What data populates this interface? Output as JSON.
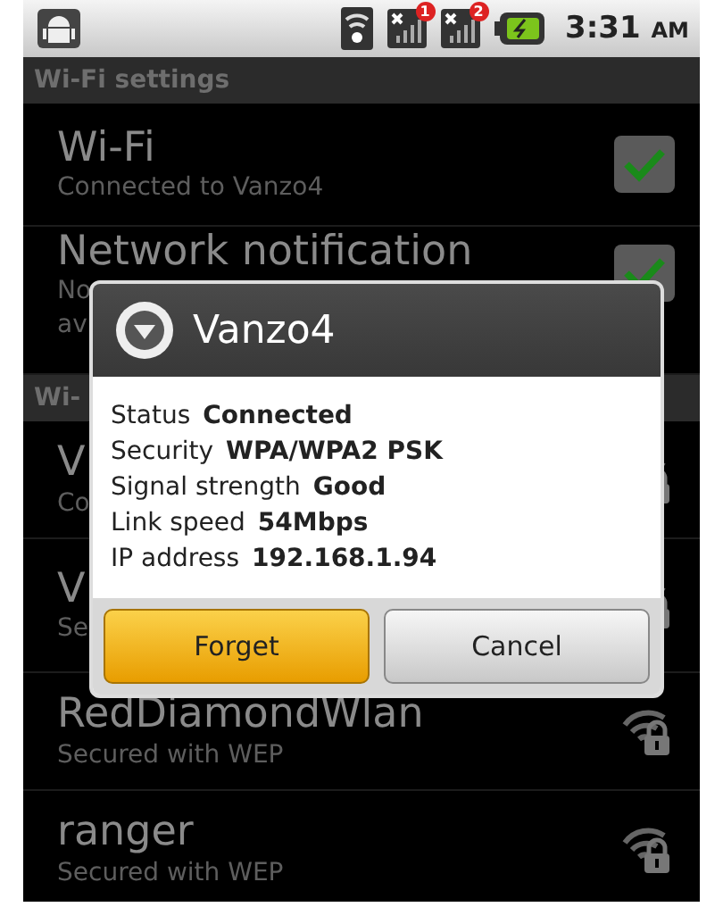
{
  "status_bar": {
    "time": "3:31",
    "meridiem": "AM",
    "sim_badges": [
      "1",
      "2"
    ]
  },
  "header": "Wi-Fi settings",
  "wifi_toggle": {
    "title": "Wi-Fi",
    "subtitle": "Connected to Vanzo4",
    "checked": true
  },
  "notification_toggle": {
    "title": "Network notification",
    "subtitle_lines": [
      "No",
      "av"
    ],
    "checked": true
  },
  "section_header": "Wi-",
  "networks": [
    {
      "name": "V",
      "detail": "Co"
    },
    {
      "name": "V",
      "detail": "Se"
    },
    {
      "name": "RedDiamondWlan",
      "detail": "Secured with WEP"
    },
    {
      "name": "ranger",
      "detail": "Secured with WEP"
    }
  ],
  "dialog": {
    "title": "Vanzo4",
    "fields": [
      {
        "label": "Status",
        "value": "Connected"
      },
      {
        "label": "Security",
        "value": "WPA/WPA2 PSK"
      },
      {
        "label": "Signal strength",
        "value": "Good"
      },
      {
        "label": "Link speed",
        "value": "54Mbps"
      },
      {
        "label": "IP address",
        "value": "192.168.1.94"
      }
    ],
    "buttons": [
      {
        "label": "Forget",
        "kind": "primary"
      },
      {
        "label": "Cancel",
        "kind": "secondary"
      }
    ]
  }
}
